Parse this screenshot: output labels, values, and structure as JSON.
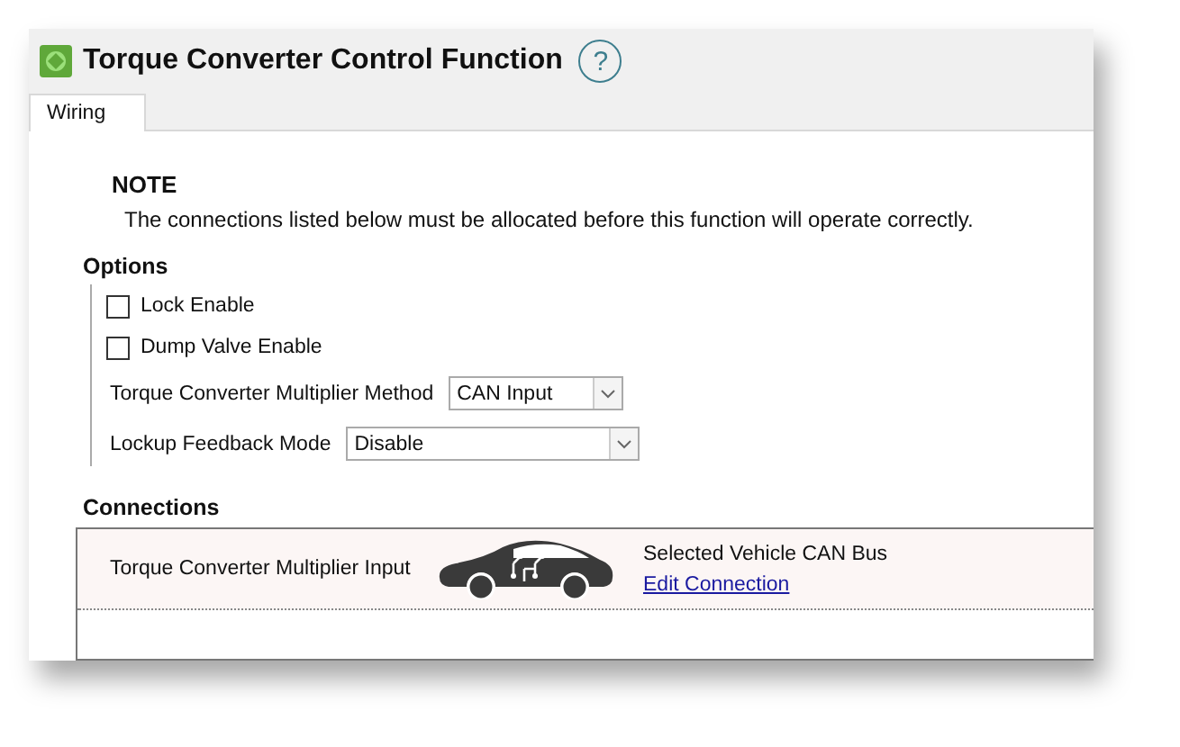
{
  "window": {
    "title": "Torque Converter Control Function",
    "help": "?"
  },
  "tabs": [
    {
      "label": "Wiring",
      "selected": true
    }
  ],
  "note": {
    "heading": "NOTE",
    "text": "The connections listed below must be allocated before this function will operate correctly."
  },
  "options": {
    "heading": "Options",
    "items": [
      {
        "kind": "checkbox",
        "label": "Lock Enable",
        "checked": false
      },
      {
        "kind": "checkbox",
        "label": "Dump Valve Enable",
        "checked": false
      },
      {
        "kind": "dropdown",
        "label": "Torque Converter Multiplier Method",
        "value": "CAN Input",
        "wide": false
      },
      {
        "kind": "dropdown",
        "label": "Lockup Feedback Mode",
        "value": "Disable",
        "wide": true
      }
    ]
  },
  "connections": {
    "heading": "Connections",
    "rows": [
      {
        "name": "Torque Converter Multiplier Input",
        "source": "Selected Vehicle CAN Bus",
        "link": "Edit Connection"
      }
    ]
  }
}
